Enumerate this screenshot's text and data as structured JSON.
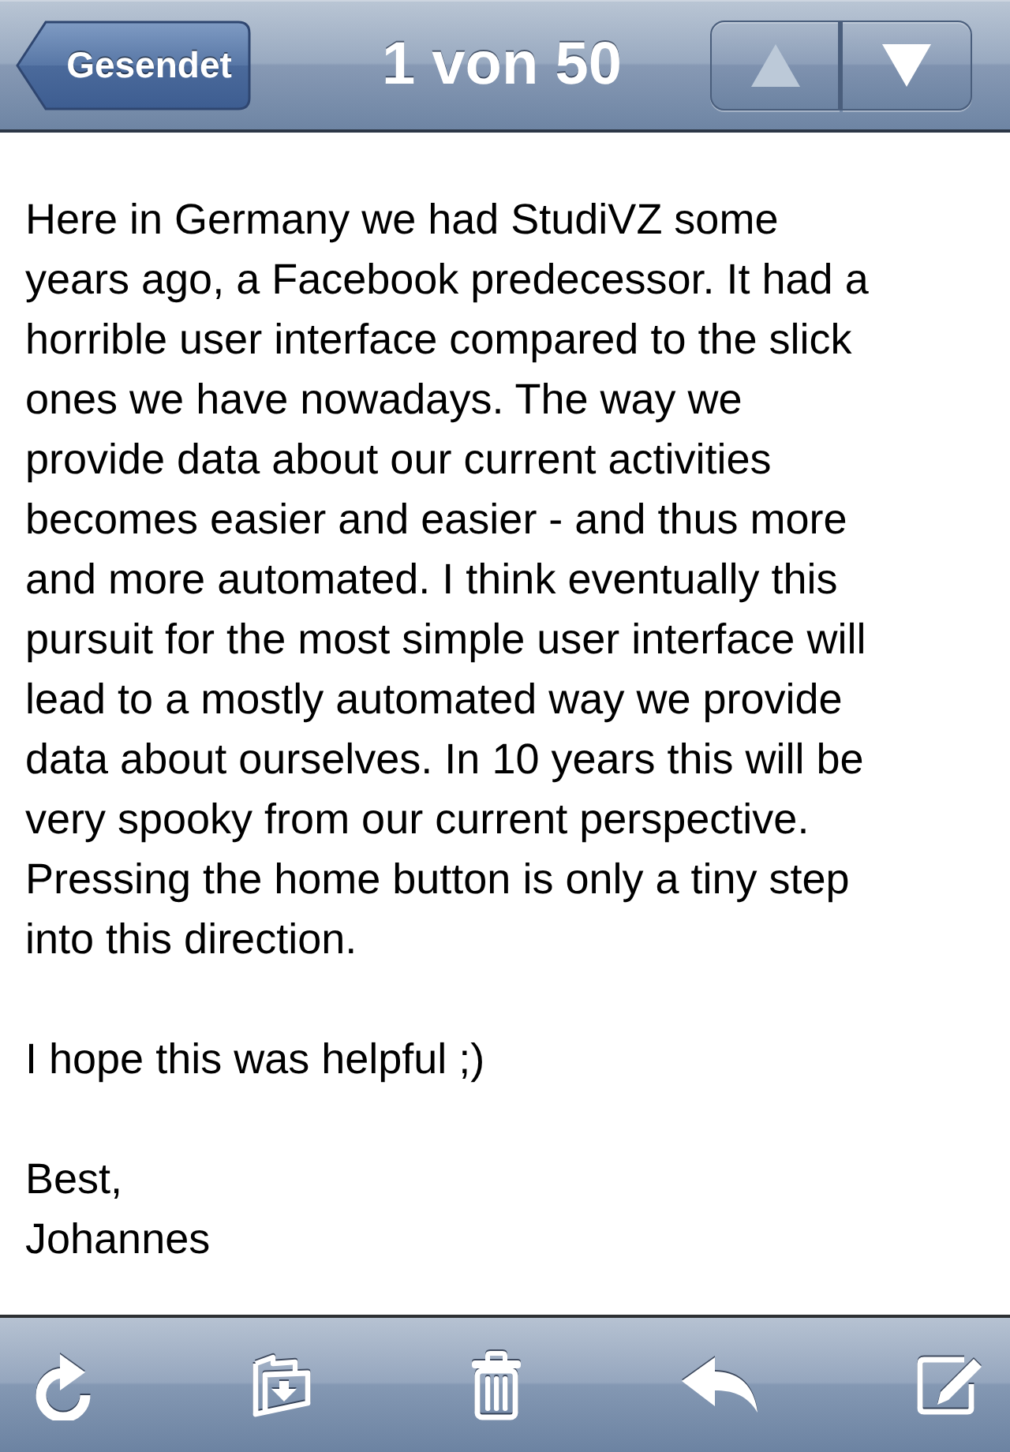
{
  "nav_bar": {
    "back_button": "Gesendet",
    "title": "1 von 50",
    "message_nav": [
      {
        "kind": "previous",
        "disabled": true
      },
      {
        "kind": "next",
        "disabled": false
      }
    ]
  },
  "message": {
    "paragraphs": [
      {
        "lines": [
          "Here in Germany we had StudiVZ some",
          "years ago, a Facebook predecessor. It had a",
          "horrible user interface compared to the slick",
          "ones we have nowadays. The way we",
          "provide data about our current activities",
          "becomes easier and easier - and thus more",
          "and more automated. I think eventually this",
          "pursuit for the most simple user interface will",
          "lead to a mostly automated way we provide",
          "data about ourselves. In 10 years this will be",
          "very spooky from our current perspective.",
          "Pressing the home button is only a tiny step",
          "into this direction."
        ]
      },
      {
        "lines": [
          "I hope this was helpful ;)"
        ]
      },
      {
        "lines": [
          "Best,",
          "Johannes"
        ]
      }
    ]
  },
  "toolbar": [
    {
      "kind": "refresh"
    },
    {
      "kind": "move"
    },
    {
      "kind": "delete"
    },
    {
      "kind": "reply"
    },
    {
      "kind": "compose"
    }
  ]
}
